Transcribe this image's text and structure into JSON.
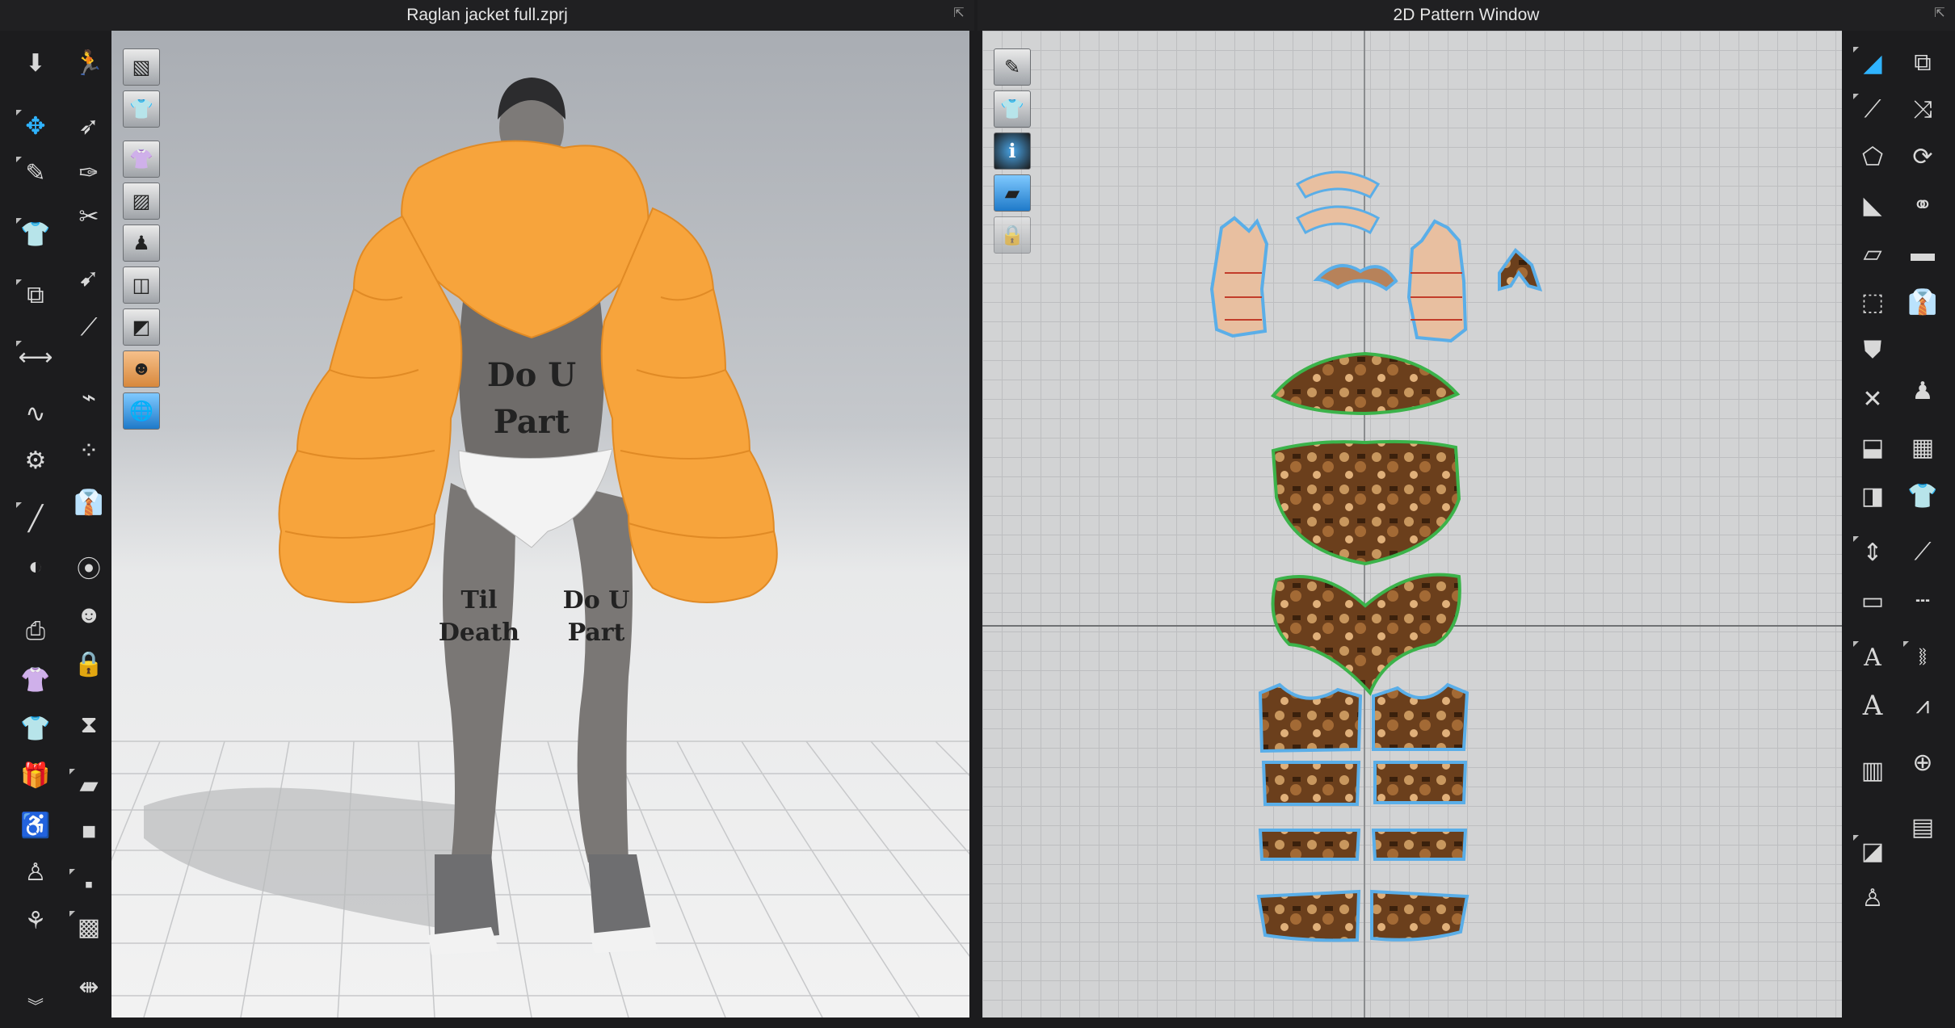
{
  "window3d": {
    "title": "Raglan jacket full.zprj",
    "popout_icon": "popout-icon",
    "viewport_icons": [
      "box-view-icon",
      "shirt-view-icon",
      "garment-show-icon",
      "fabric-texture-icon",
      "avatar-show-icon",
      "wireframe-icon",
      "shading-icon",
      "avatar-skin-icon",
      "globe-render-icon"
    ],
    "model_text": {
      "torso_line1": "Do U",
      "torso_line2": "Part",
      "left_leg_line1": "Til",
      "left_leg_line2": "Death",
      "right_leg_line1": "Do U",
      "right_leg_line2": "Part"
    },
    "colors": {
      "jacket": "#f7a43c",
      "skin": "#7a7775",
      "floor": "#ececec"
    }
  },
  "window2d": {
    "title": "2D Pattern Window",
    "popout_icon": "popout-icon",
    "viewport_icons": [
      "pattern-edit-icon",
      "shirt-pattern-icon",
      "info-icon",
      "fabric-list-icon",
      "lock-shirt-icon"
    ],
    "colors": {
      "piece_outline_blue": "#5aaee8",
      "piece_outline_green": "#3bb34a",
      "piece_fill_tan": "#e8bfa0",
      "print_brown": "#6b3f1c"
    }
  },
  "left_toolbar": [
    "simulation-icon",
    "avatar-walk-icon",
    "select-move-icon",
    "select-mesh-icon",
    "pin-icon",
    "brush-icon",
    "fold-icon",
    "tack-icon",
    "sewing-icon",
    "arrange-icon",
    "pose-icon",
    "measure-icon",
    "pen-icon",
    "puckering-icon",
    "needle-icon",
    "zipper-icon",
    "button-icon",
    "buttonhole-icon",
    "snap-icon",
    "trims-icon",
    "garment-fit-icon",
    "pressure-icon",
    "avatar-icon",
    "strap-icon",
    "fitting-suit-icon",
    "size-icon",
    "more-tools-icon"
  ],
  "right_toolbar": [
    "edit-pattern-icon",
    "transform-icon",
    "polygon-icon",
    "rectangle-icon",
    "internal-shape-icon",
    "dart-icon",
    "segment-icon",
    "trace-icon",
    "seam-allowance-icon",
    "pleat-icon",
    "sewing-line-icon",
    "length-icon",
    "text-icon",
    "grading-icon",
    "annotation-icon",
    "topstitch-icon",
    "ruler-icon",
    "avatar-dress-icon"
  ]
}
